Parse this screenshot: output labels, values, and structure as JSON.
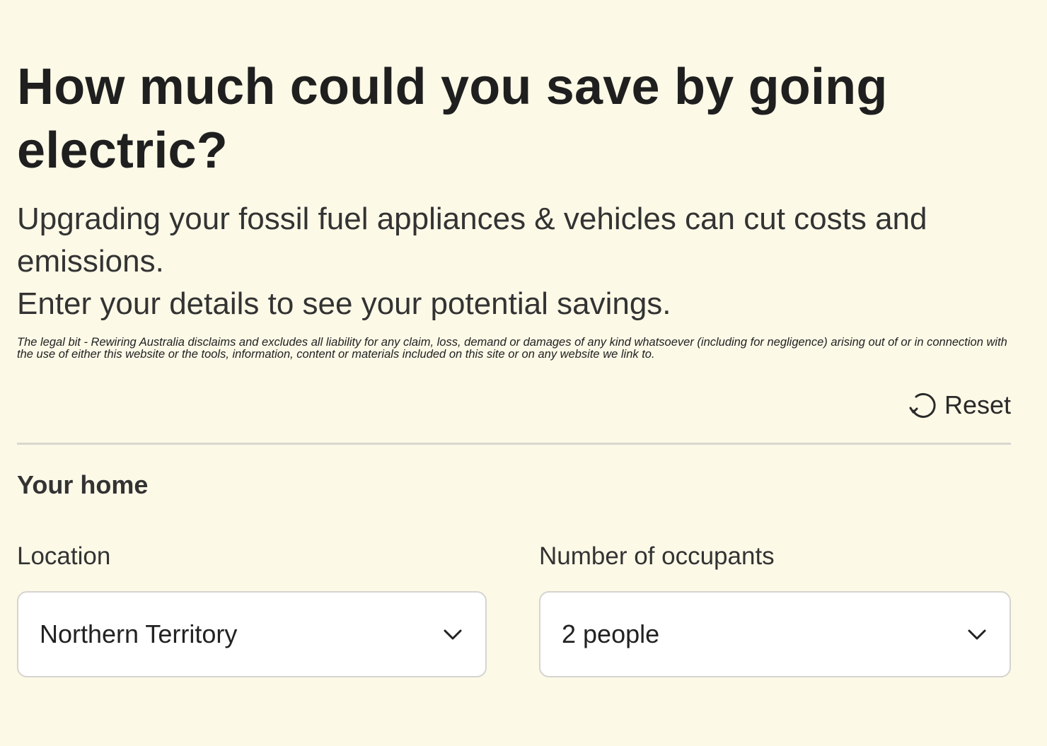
{
  "header": {
    "title": "How much could you save by going electric?",
    "subtitle_line1": "Upgrading your fossil fuel appliances & vehicles can cut costs and emissions.",
    "subtitle_line2": "Enter your details to see your potential savings.",
    "legal": "The legal bit - Rewiring Australia disclaims and excludes all liability for any claim, loss, demand or damages of any kind whatsoever (including for negligence) arising out of or in connection with the use of either this website or the tools, information, content or materials included on this site or on any website we link to."
  },
  "toolbar": {
    "reset_label": "Reset",
    "reset_icon": "reset-icon"
  },
  "home": {
    "section_title": "Your home",
    "location": {
      "label": "Location",
      "value": "Northern Territory",
      "icon": "chevron-down-icon"
    },
    "occupants": {
      "label": "Number of occupants",
      "value": "2 people",
      "icon": "chevron-down-icon"
    }
  },
  "colors": {
    "background": "#fcf9e7",
    "text": "#222222",
    "divider": "#d9d7d0",
    "select_bg": "#ffffff",
    "select_border": "#d6d4cf"
  }
}
